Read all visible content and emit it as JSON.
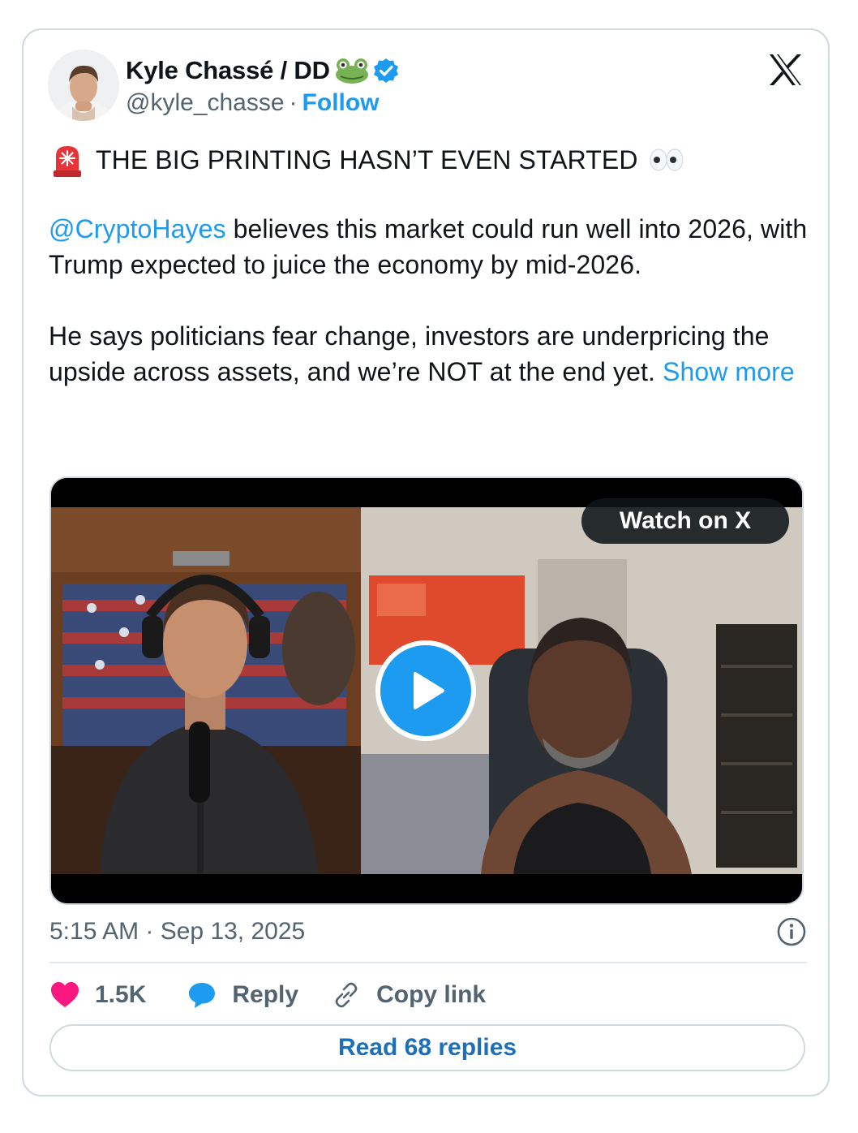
{
  "author": {
    "name": "Kyle Chassé / DD",
    "handle": "@kyle_chasse",
    "separator": "·",
    "follow_label": "Follow",
    "emoji_icon": "frog-emoji",
    "verified_icon": "verified-badge"
  },
  "tweet": {
    "headline": "THE BIG PRINTING HASN’T EVEN STARTED",
    "headline_prefix_icon": "police-siren-emoji",
    "headline_suffix_icon": "eyes-emoji",
    "mention": "@CryptoHayes",
    "paragraph2_rest": " believes this market could run well into 2026, with Trump expected to juice the economy by mid-2026.",
    "paragraph3": "He says politicians fear change, investors are underpricing the upside across assets, and we’re NOT at the end yet. ",
    "show_more": "Show more"
  },
  "media": {
    "watch_label": "Watch on X",
    "play_icon": "play-icon"
  },
  "meta": {
    "timestamp": "5:15 AM · Sep 13, 2025"
  },
  "actions": {
    "likes": "1.5K",
    "reply_label": "Reply",
    "copy_label": "Copy link",
    "read_replies": "Read 68 replies"
  },
  "colors": {
    "accent": "#1d9bf0",
    "like": "#f91880",
    "border": "#cfd9de"
  }
}
